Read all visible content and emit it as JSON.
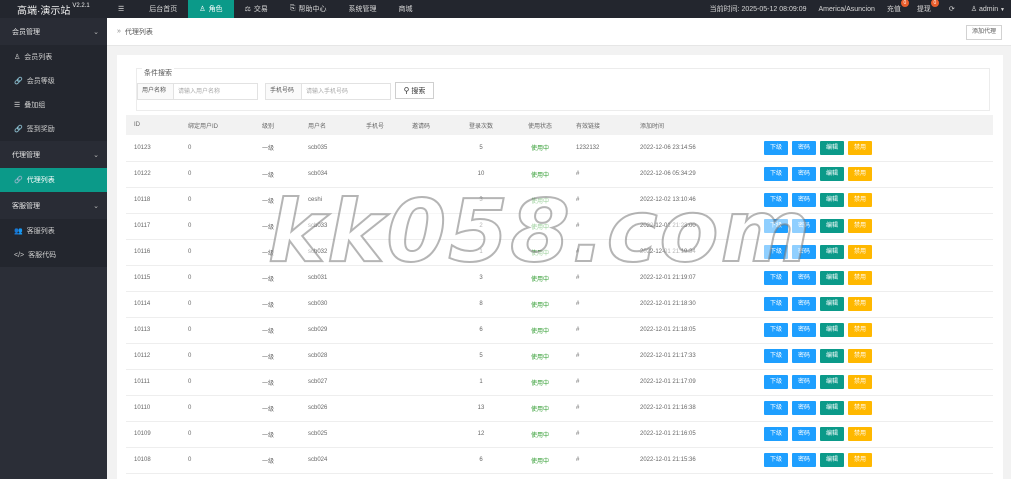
{
  "app": {
    "title": "高端·演示站",
    "version": "V2.2.1"
  },
  "topnav": [
    {
      "icon": "menu-icon",
      "glyph": "☰",
      "label": ""
    },
    {
      "icon": "",
      "glyph": "",
      "label": "后台首页"
    },
    {
      "icon": "users-icon",
      "glyph": "♙",
      "label": "角色",
      "active": true
    },
    {
      "icon": "scale-icon",
      "glyph": "⚖",
      "label": "交易"
    },
    {
      "icon": "help-icon",
      "glyph": "⎘",
      "label": "帮助中心"
    },
    {
      "icon": "",
      "glyph": "",
      "label": "系统管理"
    },
    {
      "icon": "",
      "glyph": "",
      "label": "商城"
    }
  ],
  "topright": {
    "time_label": "当前时间: 2025-05-12 08:09:09",
    "timezone": "America/Asuncion",
    "recharge": "充值",
    "recharge_badge": "0",
    "withdraw": "提现",
    "withdraw_badge": "0",
    "user": "admin"
  },
  "sidebar": {
    "groups": [
      {
        "label": "会员管理",
        "items": [
          {
            "icon": "user-icon",
            "glyph": "♙",
            "label": "会员列表"
          },
          {
            "icon": "link-icon",
            "glyph": "🔗",
            "label": "会员等级"
          },
          {
            "icon": "list-icon",
            "glyph": "☰",
            "label": "叠加组"
          },
          {
            "icon": "link-icon",
            "glyph": "🔗",
            "label": "签到奖励"
          }
        ]
      },
      {
        "label": "代理管理",
        "items": [
          {
            "icon": "link-icon",
            "glyph": "🔗",
            "label": "代理列表",
            "active": true
          }
        ]
      },
      {
        "label": "客服管理",
        "items": [
          {
            "icon": "group-icon",
            "glyph": "👥",
            "label": "客服列表"
          },
          {
            "icon": "code-icon",
            "glyph": "</>",
            "label": "客服代码"
          }
        ]
      }
    ]
  },
  "breadcrumb": {
    "arrow": "»",
    "label": "代理列表",
    "add_button": "添加代理"
  },
  "filter": {
    "legend": "条件搜索",
    "username_label": "用户名称",
    "username_placeholder": "请输入用户名称",
    "phone_label": "手机号码",
    "phone_placeholder": "请输入手机号码",
    "search_button": "搜索"
  },
  "table": {
    "columns": [
      "ID",
      "绑定用户ID",
      "级别",
      "用户名",
      "手机号",
      "邀请码",
      "登录次数",
      "使用状态",
      "有效链接",
      "添加时间",
      ""
    ],
    "actions": [
      "下级",
      "密码",
      "编辑",
      "禁用"
    ],
    "rows": [
      [
        "10123",
        "0",
        "一级",
        "scb035",
        "",
        "",
        "5",
        "使用中",
        "1232132",
        "2022-12-06 23:14:56"
      ],
      [
        "10122",
        "0",
        "一级",
        "scb034",
        "",
        "",
        "10",
        "使用中",
        "#",
        "2022-12-06 05:34:29"
      ],
      [
        "10118",
        "0",
        "一级",
        "ceshi",
        "",
        "",
        "3",
        "使用中",
        "#",
        "2022-12-02 13:10:46"
      ],
      [
        "10117",
        "0",
        "一级",
        "scb033",
        "",
        "",
        "2",
        "使用中",
        "#",
        "2022-12-01 21:23:00"
      ],
      [
        "10116",
        "0",
        "一级",
        "scb032",
        "",
        "",
        "1",
        "使用中",
        "#",
        "2022-12-01 21:19:34"
      ],
      [
        "10115",
        "0",
        "一级",
        "scb031",
        "",
        "",
        "3",
        "使用中",
        "#",
        "2022-12-01 21:19:07"
      ],
      [
        "10114",
        "0",
        "一级",
        "scb030",
        "",
        "",
        "8",
        "使用中",
        "#",
        "2022-12-01 21:18:30"
      ],
      [
        "10113",
        "0",
        "一级",
        "scb029",
        "",
        "",
        "6",
        "使用中",
        "#",
        "2022-12-01 21:18:05"
      ],
      [
        "10112",
        "0",
        "一级",
        "scb028",
        "",
        "",
        "5",
        "使用中",
        "#",
        "2022-12-01 21:17:33"
      ],
      [
        "10111",
        "0",
        "一级",
        "scb027",
        "",
        "",
        "1",
        "使用中",
        "#",
        "2022-12-01 21:17:09"
      ],
      [
        "10110",
        "0",
        "一级",
        "scb026",
        "",
        "",
        "13",
        "使用中",
        "#",
        "2022-12-01 21:16:38"
      ],
      [
        "10109",
        "0",
        "一级",
        "scb025",
        "",
        "",
        "12",
        "使用中",
        "#",
        "2022-12-01 21:16:05"
      ],
      [
        "10108",
        "0",
        "一级",
        "scb024",
        "",
        "",
        "6",
        "使用中",
        "#",
        "2022-12-01 21:15:36"
      ]
    ]
  },
  "watermark": "kk058.com",
  "colors": {
    "accent": "#0b9a89",
    "topbar": "#23262e",
    "sidebar": "#2b2e37",
    "blue": "#1e9fff",
    "yellow": "#ffb800",
    "status_on": "#2e9b2e"
  }
}
